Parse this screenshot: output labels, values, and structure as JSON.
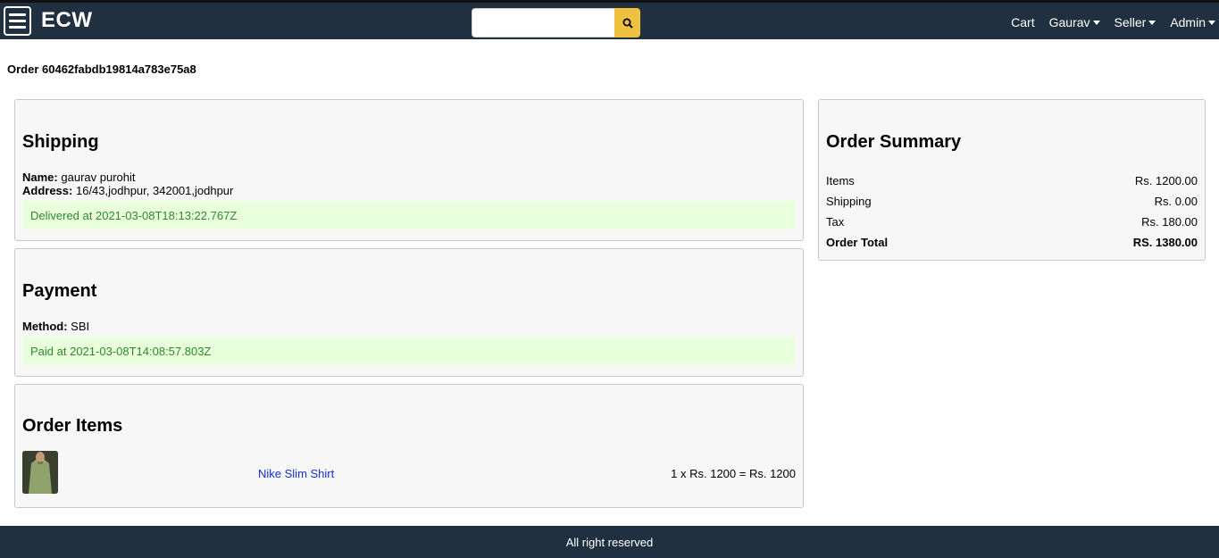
{
  "header": {
    "brand": "ECW",
    "search_value": "",
    "nav": {
      "cart": "Cart",
      "user": "Gaurav",
      "seller": "Seller",
      "admin": "Admin"
    }
  },
  "order": {
    "title": "Order 60462fabdb19814a783e75a8"
  },
  "shipping": {
    "heading": "Shipping",
    "name_label": "Name:",
    "name_value": "gaurav purohit",
    "address_label": "Address:",
    "address_value": "16/43,jodhpur, 342001,jodhpur",
    "status": "Delivered at 2021-03-08T18:13:22.767Z"
  },
  "payment": {
    "heading": "Payment",
    "method_label": "Method:",
    "method_value": "SBI",
    "status": "Paid at 2021-03-08T14:08:57.803Z"
  },
  "order_items": {
    "heading": "Order Items",
    "items": [
      {
        "name": "Nike Slim Shirt",
        "line_total": "1 x Rs. 1200 = Rs. 1200"
      }
    ]
  },
  "summary": {
    "heading": "Order Summary",
    "rows": [
      {
        "label": "Items",
        "value": "Rs. 1200.00"
      },
      {
        "label": "Shipping",
        "value": "Rs. 0.00"
      },
      {
        "label": "Tax",
        "value": "Rs. 180.00"
      },
      {
        "label": "Order Total",
        "value": "RS. 1380.00"
      }
    ]
  },
  "footer": {
    "text": "All right reserved"
  },
  "colors": {
    "header_bg": "#203040",
    "search_button": "#f0c040",
    "success_bg": "#eaffdc",
    "success_text": "#2c8a2c",
    "link": "#1530d0"
  }
}
